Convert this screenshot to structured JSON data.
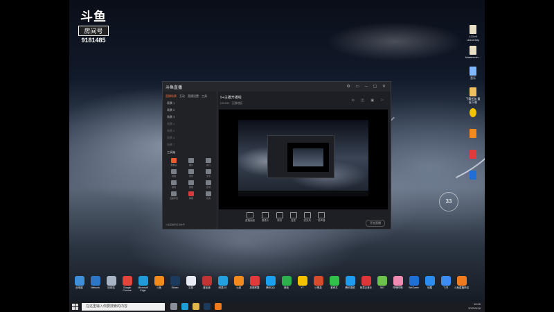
{
  "logo": {
    "mark": "斗鱼",
    "label": "房间号",
    "room_id": "9181485"
  },
  "desktop_right_icons": [
    {
      "label": "123.rtf University",
      "color": "#e9e0c4"
    },
    {
      "label": "Mastermin...",
      "color": "#e9e0c4"
    },
    {
      "label": "音乐",
      "color": "#7fb8ff"
    },
    {
      "label": "下载任务 重复下载",
      "color": "#f0c060"
    }
  ],
  "weather": {
    "temp": "33"
  },
  "app_window": {
    "title": "斗鱼直播",
    "sidebar_tabs": [
      "直播场景",
      "互动",
      "直播设置",
      "工具"
    ],
    "scenes": [
      "场景 1",
      "场景 2",
      "场景 3"
    ],
    "dim_scenes": [
      "场景 4",
      "场景 5",
      "场景 6",
      "场景 7"
    ],
    "tools_title": "工具箱",
    "tools": [
      {
        "label": "摄像头",
        "tone": "orange"
      },
      {
        "label": "图片",
        "tone": ""
      },
      {
        "label": "窗口",
        "tone": ""
      },
      {
        "label": "视频",
        "tone": ""
      },
      {
        "label": "音乐",
        "tone": ""
      },
      {
        "label": "文字",
        "tone": ""
      },
      {
        "label": "游戏",
        "tone": ""
      },
      {
        "label": "屏幕",
        "tone": ""
      },
      {
        "label": "区域",
        "tone": ""
      },
      {
        "label": "直播伴侣",
        "tone": ""
      },
      {
        "label": "弹幕",
        "tone": "red"
      },
      {
        "label": "礼物",
        "tone": ""
      }
    ],
    "sidebar_footer": "斗鱼直播伴侣 版本号",
    "stream_title": "9+主播开播啦",
    "stream_sub": "CS:GO · 无限地区",
    "bottom_actions": [
      "直播画面",
      "摄像头",
      "录制",
      "连麦",
      "麦克风",
      "扬声器"
    ],
    "start_button": "开始直播"
  },
  "dock_icons": [
    {
      "label": "此电脑",
      "color": "#3f8fd9"
    },
    {
      "label": "Network",
      "color": "#2c76c8"
    },
    {
      "label": "回收站",
      "color": "#a8b4c4"
    },
    {
      "label": "Google Chrome",
      "color": "#e2463a"
    },
    {
      "label": "Microsoft Edge",
      "color": "#1f9bd7"
    },
    {
      "label": "斗鱼",
      "color": "#f38b1c"
    },
    {
      "label": "Steam",
      "color": "#1b3a5c"
    },
    {
      "label": "文档",
      "color": "#e8ecf2"
    },
    {
      "label": "爱加速",
      "color": "#c03434"
    },
    {
      "label": "网易UU",
      "color": "#23a0e0"
    },
    {
      "label": "火绒",
      "color": "#f28a1e"
    },
    {
      "label": "英雄联盟",
      "color": "#e03a3a"
    },
    {
      "label": "腾讯QQ",
      "color": "#1aa0f0"
    },
    {
      "label": "微信",
      "color": "#2bb24c"
    },
    {
      "label": "YY",
      "color": "#f2c200"
    },
    {
      "label": "小黑盒",
      "color": "#d64b2b"
    },
    {
      "label": "爱奇艺",
      "color": "#31c04a"
    },
    {
      "label": "腾讯视频",
      "color": "#1f9cf0"
    },
    {
      "label": "网易云音乐",
      "color": "#dd3636"
    },
    {
      "label": "360",
      "color": "#6cc24a"
    },
    {
      "label": "哔哩哔哩",
      "color": "#f08ab0"
    },
    {
      "label": "WeGame",
      "color": "#1f6fd6"
    },
    {
      "label": "优酷",
      "color": "#2c8cf0"
    },
    {
      "label": "飞书",
      "color": "#3c8cf2"
    },
    {
      "label": "斗鱼直播伴侣",
      "color": "#f07a1e"
    }
  ],
  "taskbar": {
    "search_placeholder": "在这里输入你要搜索的内容",
    "clock_time": "10:00",
    "clock_date": "2022/5/16"
  }
}
